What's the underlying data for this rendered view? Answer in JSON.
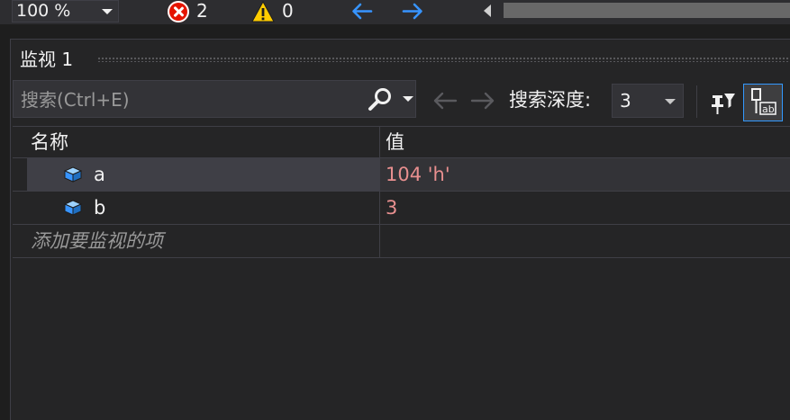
{
  "statusbar": {
    "zoom": "100 %",
    "errors": "2",
    "warnings": "0"
  },
  "watch": {
    "title": "监视 1",
    "search_placeholder": "搜索(Ctrl+E)",
    "depth_label": "搜索深度:",
    "depth_value": "3",
    "columns": {
      "name": "名称",
      "value": "值"
    },
    "rows": [
      {
        "name": "a",
        "value": "104 'h'"
      },
      {
        "name": "b",
        "value": "3"
      }
    ],
    "add_item_placeholder": "添加要监视的项"
  },
  "colors": {
    "accent": "#3399ff",
    "value_changed": "#e88f8f",
    "error": "#e51400",
    "warning": "#ffcc00"
  },
  "icons": {
    "error": "error-circle-icon",
    "warning": "warning-triangle-icon",
    "search": "search-icon",
    "variable": "field-cube-icon",
    "pin": "pin-icon",
    "hex": "hex-display-icon"
  }
}
